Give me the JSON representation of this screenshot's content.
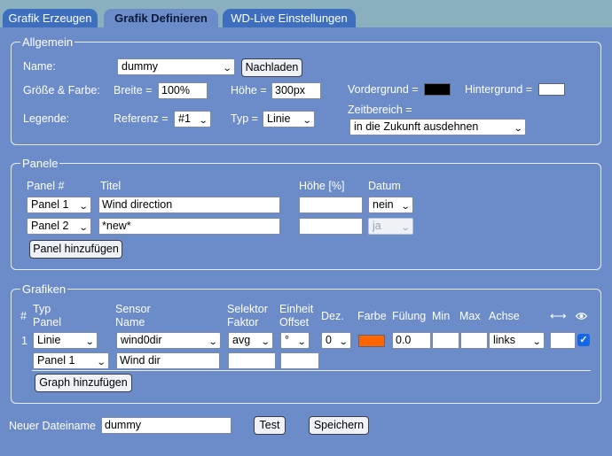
{
  "tabs": [
    {
      "label": "Grafik Erzeugen"
    },
    {
      "label": "Grafik Definieren"
    },
    {
      "label": "WD-Live Einstellungen"
    }
  ],
  "allgemein": {
    "legend": "Allgemein",
    "name_label": "Name:",
    "name_value": "dummy",
    "reload_button": "Nachladen",
    "size_color_label": "Größe & Farbe:",
    "width_label": "Breite =",
    "width_value": "100%",
    "height_label": "Höhe =",
    "height_value": "300px",
    "foreground_label": "Vordergrund =",
    "foreground_color": "#000000",
    "background_label": "Hintergrund =",
    "background_color": "#ffffff",
    "legend_label": "Legende:",
    "reference_label": "Referenz =",
    "reference_value": "#1",
    "type_label": "Typ =",
    "type_value": "Linie",
    "timerange_label": "Zeitbereich =",
    "timerange_value": "in die Zukunft ausdehnen"
  },
  "panele": {
    "legend": "Panele",
    "headers": {
      "panel": "Panel #",
      "title": "Titel",
      "height": "Höhe [%]",
      "date": "Datum"
    },
    "rows": [
      {
        "panel": "Panel 1",
        "title": "Wind direction",
        "height": "",
        "date": "nein"
      },
      {
        "panel": "Panel 2",
        "title": "*new*",
        "height": "",
        "date": "ja"
      }
    ],
    "add_button": "Panel hinzufügen"
  },
  "grafiken": {
    "legend": "Grafiken",
    "headers": {
      "index": "#",
      "type": "Typ",
      "panel": "Panel",
      "sensor": "Sensor",
      "name": "Name",
      "selector": "Selektor",
      "factor": "Faktor",
      "unit": "Einheit",
      "offset": "Offset",
      "decimals": "Dez.",
      "color": "Farbe",
      "fill": "Fülung",
      "min": "Min",
      "max": "Max",
      "axis": "Achse"
    },
    "row": {
      "index": "1",
      "type": "Linie",
      "panel": "Panel 1",
      "sensor": "wind0dir",
      "name": "Wind dir",
      "selector": "avg",
      "factor": "",
      "unit": "°",
      "offset": "",
      "decimals": "0",
      "color": "#ff6600",
      "fill": "0.0",
      "min": "",
      "max": "",
      "axis": "links",
      "width": "",
      "visible": true
    },
    "add_button": "Graph hinzufügen"
  },
  "footer": {
    "filename_label": "Neuer Dateiname",
    "filename_value": "dummy",
    "test_button": "Test",
    "save_button": "Speichern"
  },
  "icons": {
    "width": "arrows-horizontal-icon",
    "visible": "eye-icon",
    "checkbox": "checkmark-icon"
  }
}
